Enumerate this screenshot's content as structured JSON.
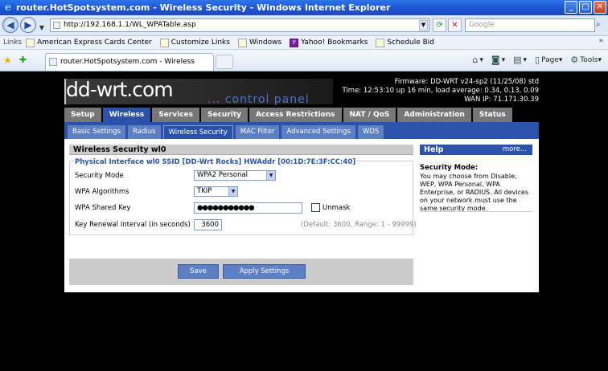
{
  "window": {
    "title": "router.HotSpotsystem.com - Wireless Security - Windows Internet Explorer",
    "minimize": "_",
    "maximize": "□",
    "close": "✕"
  },
  "address": {
    "url": "http://192.168.1.1/WL_WPATable.asp",
    "search_placeholder": "Google"
  },
  "links_bar": {
    "label": "Links",
    "items": [
      {
        "label": "American Express Cards Center"
      },
      {
        "label": "Customize Links"
      },
      {
        "label": "Windows"
      },
      {
        "label": "Yahoo! Bookmarks"
      },
      {
        "label": "Schedule Bid"
      }
    ],
    "more": "»"
  },
  "tab": {
    "label": "router.HotSpotsystem.com - Wireless Security"
  },
  "commands": {
    "page": "Page",
    "tools": "Tools"
  },
  "router": {
    "logo": "dd-wrt.com",
    "subtitle": "... control panel",
    "firmware": "Firmware: DD-WRT v24-sp2 (11/25/08) std",
    "time": "Time: 12:53:10 up 16 min, load average: 0.34, 0.13, 0.09",
    "wan_ip": "WAN IP: 71.171.30.39",
    "main_tabs": [
      {
        "label": "Setup"
      },
      {
        "label": "Wireless"
      },
      {
        "label": "Services"
      },
      {
        "label": "Security"
      },
      {
        "label": "Access Restrictions"
      },
      {
        "label": "NAT / QoS"
      },
      {
        "label": "Administration"
      },
      {
        "label": "Status"
      }
    ],
    "sub_tabs": [
      {
        "label": "Basic Settings"
      },
      {
        "label": "Radius"
      },
      {
        "label": "Wireless Security"
      },
      {
        "label": "MAC Filter"
      },
      {
        "label": "Advanced Settings"
      },
      {
        "label": "WDS"
      }
    ],
    "section_title": "Wireless Security wl0",
    "legend": "Physical Interface wl0 SSID [DD-Wrt Rocks] HWAddr [00:1D:7E:3F:CC:40]",
    "fields": {
      "security_mode": {
        "label": "Security Mode",
        "value": "WPA2 Personal"
      },
      "wpa_algorithms": {
        "label": "WPA Algorithms",
        "value": "TKIP"
      },
      "shared_key": {
        "label": "WPA Shared Key",
        "value": "●●●●●●●●●●●",
        "unmask": "Unmask"
      },
      "renewal": {
        "label": "Key Renewal Interval (in seconds)",
        "value": "3600",
        "hint": "(Default: 3600, Range: 1 - 99999)"
      }
    },
    "buttons": {
      "save": "Save",
      "apply": "Apply Settings"
    },
    "help": {
      "title": "Help",
      "more": "more...",
      "subtitle": "Security Mode:",
      "text": "You may choose from Disable, WEP, WPA Personal, WPA Enterprise, or RADIUS. All devices on your network must use the same security mode."
    }
  }
}
